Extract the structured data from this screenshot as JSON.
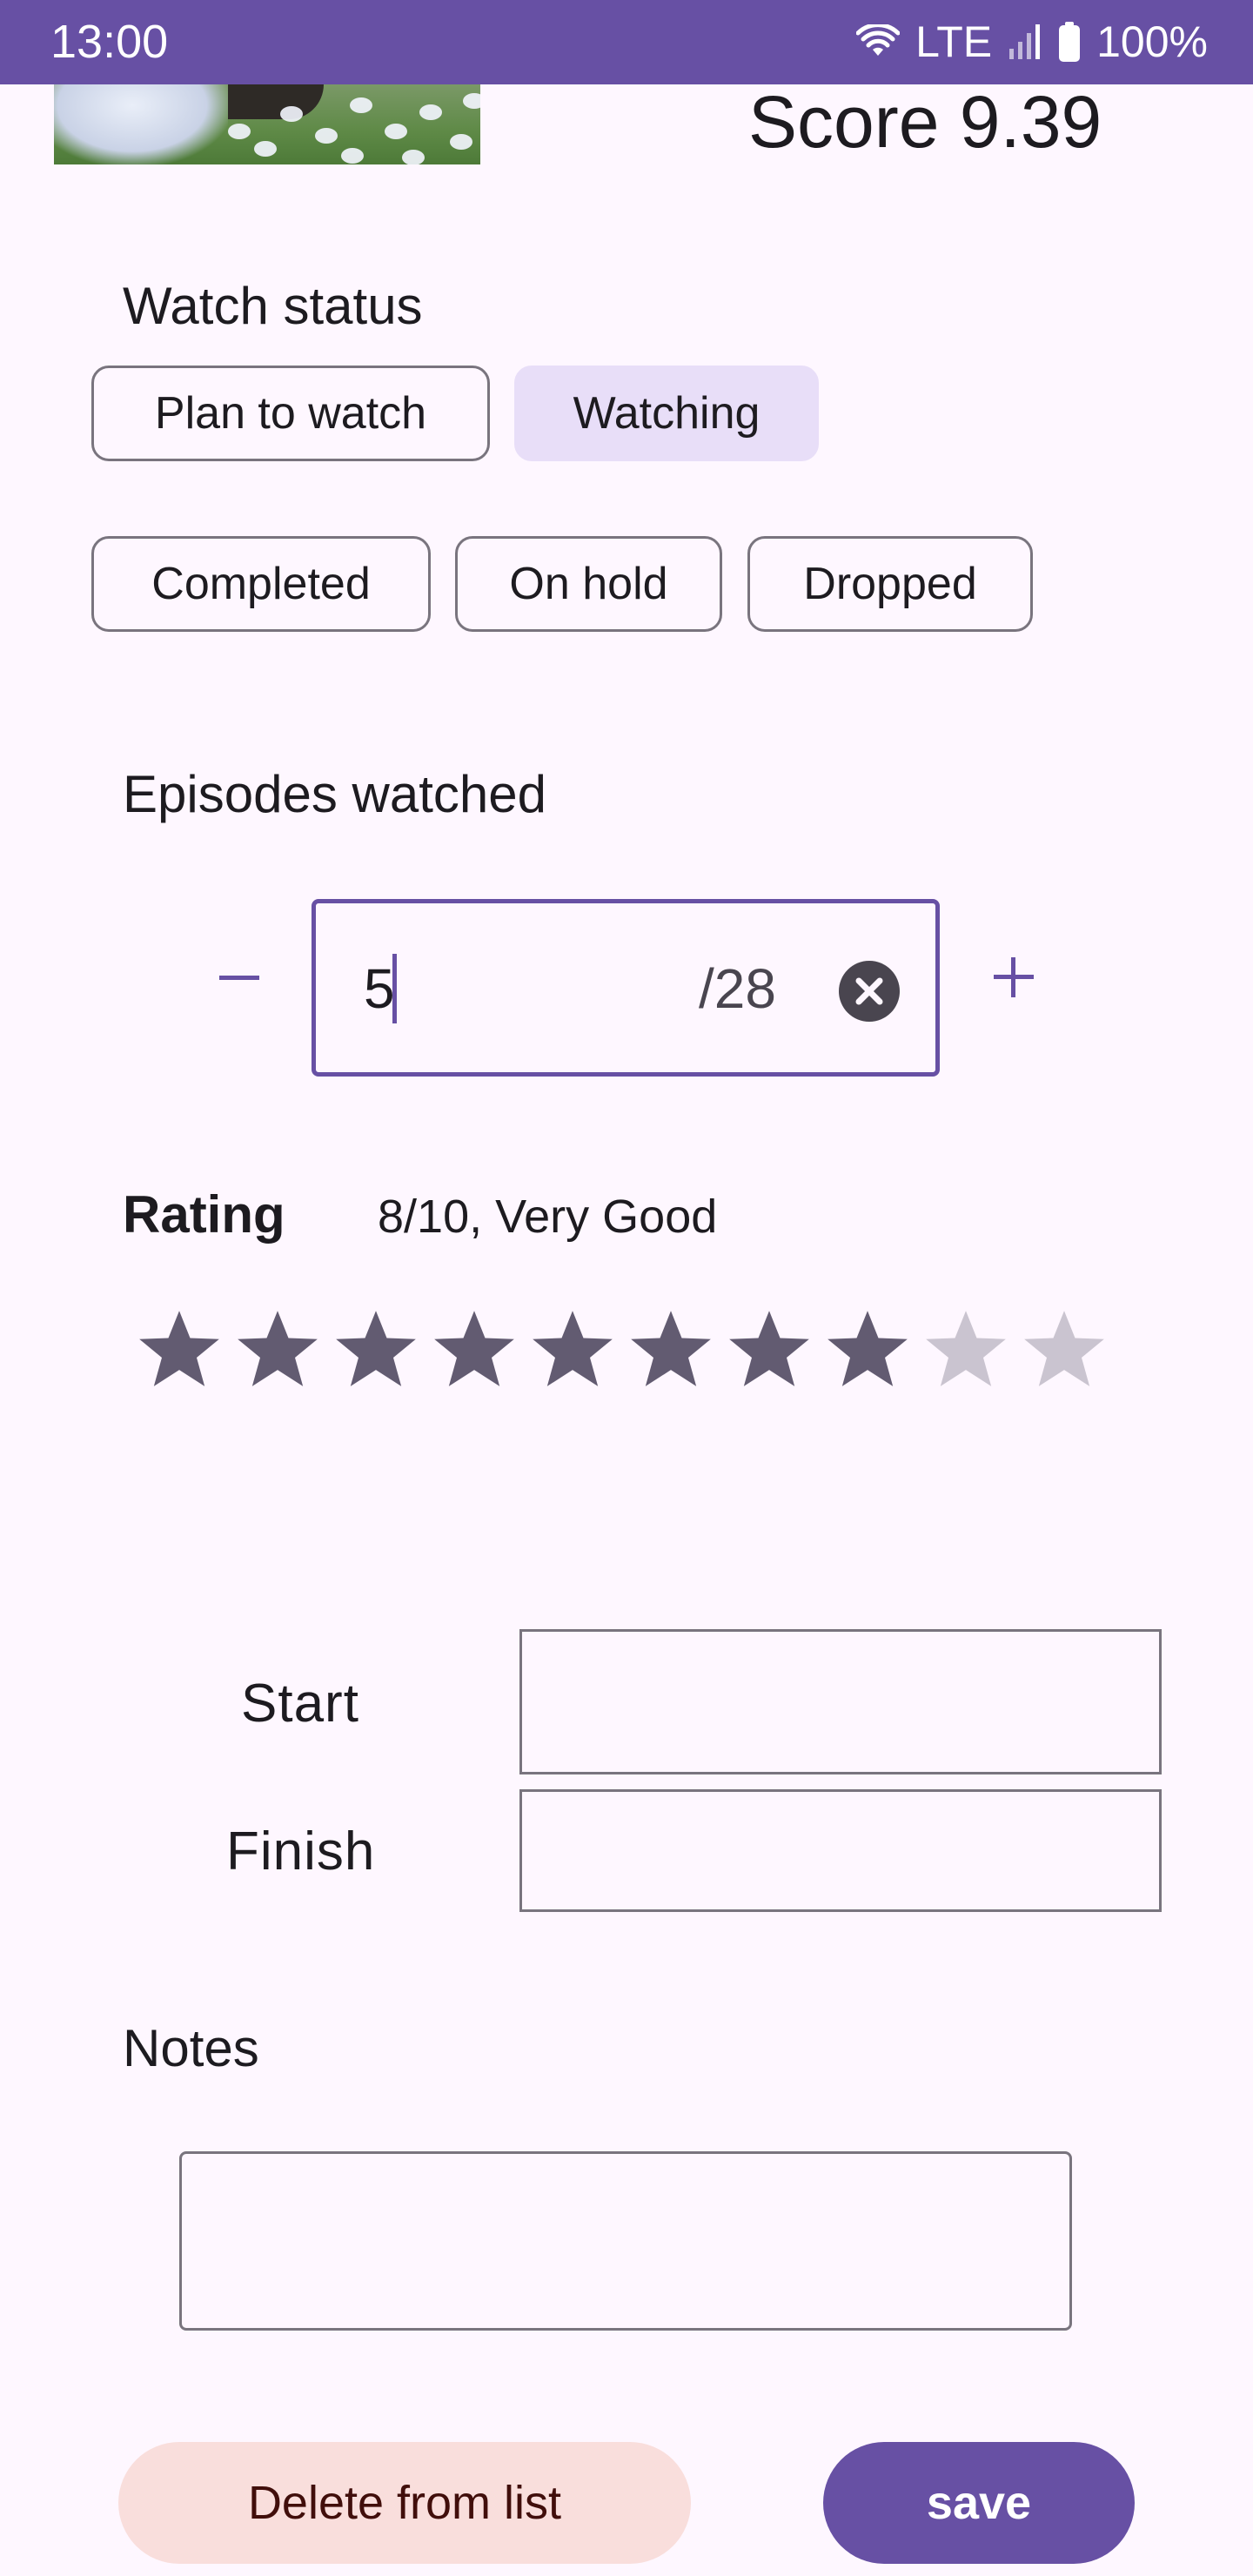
{
  "status_bar": {
    "time": "13:00",
    "network": "LTE",
    "battery": "100%"
  },
  "header": {
    "score": "Score 9.39"
  },
  "watch_status": {
    "title": "Watch status",
    "options": [
      "Plan to watch",
      "Watching",
      "Completed",
      "On hold",
      "Dropped"
    ],
    "selected": "Watching"
  },
  "episodes": {
    "title": "Episodes watched",
    "value": "5",
    "total": "/28",
    "decrement_symbol": "−",
    "increment_symbol": "+"
  },
  "rating": {
    "title": "Rating",
    "text": "8/10, Very Good",
    "value": 8,
    "max": 10
  },
  "dates": {
    "start_label": "Start",
    "finish_label": "Finish"
  },
  "notes": {
    "title": "Notes"
  },
  "actions": {
    "delete_label": "Delete from list",
    "save_label": "save"
  },
  "colors": {
    "primary": "#6750A4",
    "background": "#FEF7FF",
    "chip_selected": "#E8DEF8",
    "star_filled": "#625B71",
    "star_empty": "#CAC4D0",
    "delete_bg": "#F9DEDC"
  },
  "icons": {
    "wifi": "wifi-icon",
    "signal": "signal-icon",
    "battery": "battery-icon",
    "clear": "clear-circle-icon",
    "star": "star-icon"
  }
}
